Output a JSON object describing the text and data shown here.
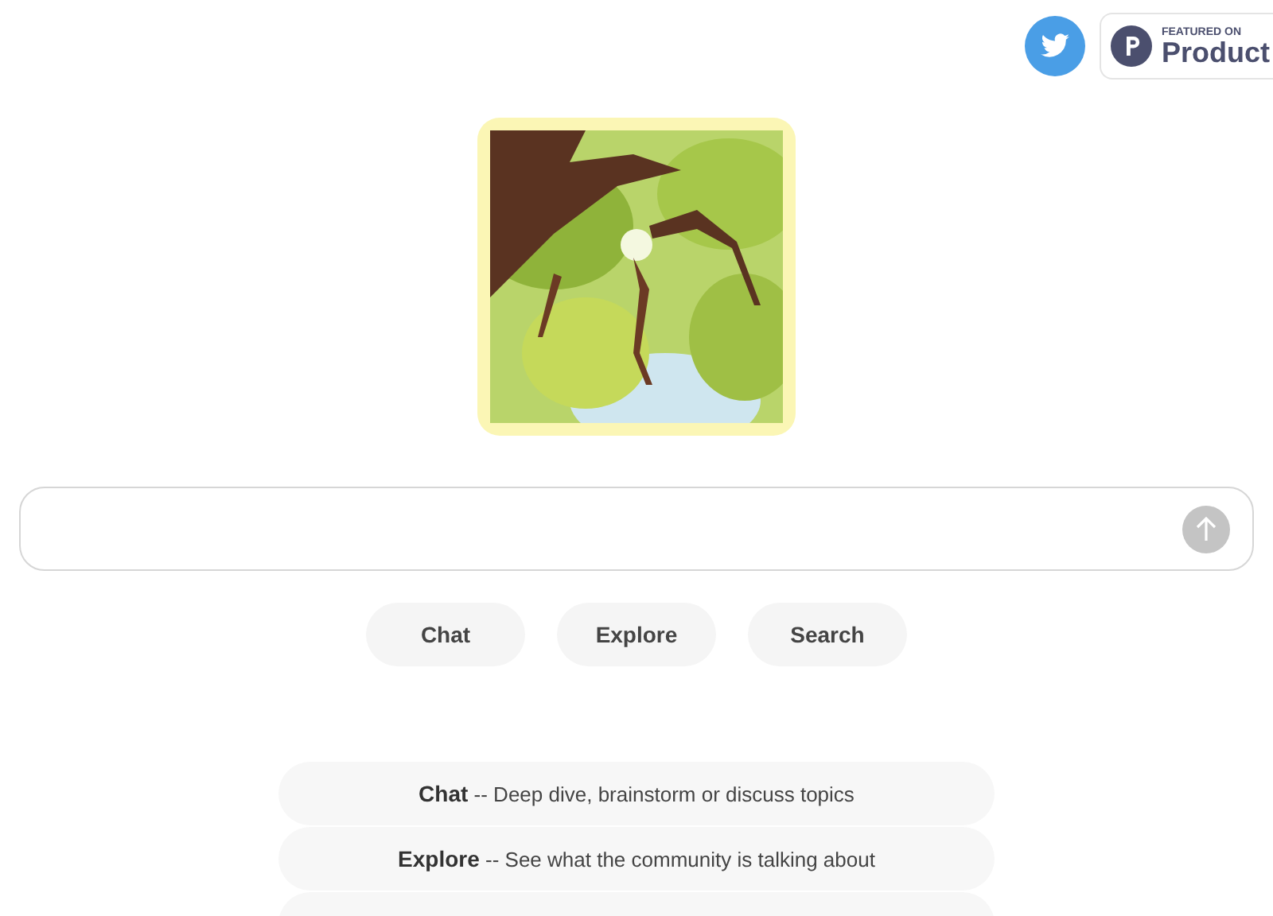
{
  "header": {
    "badge": {
      "caption": "FEATURED ON",
      "name": "Product"
    }
  },
  "prompt": {
    "send_disabled": true
  },
  "modes": [
    {
      "label": "Chat"
    },
    {
      "label": "Explore"
    },
    {
      "label": "Search"
    }
  ],
  "descriptions": [
    {
      "text": "**Chat** -- Deep dive, brainstorm or discuss topics"
    },
    {
      "text": "**Explore** -- See what the community is talking about"
    }
  ]
}
